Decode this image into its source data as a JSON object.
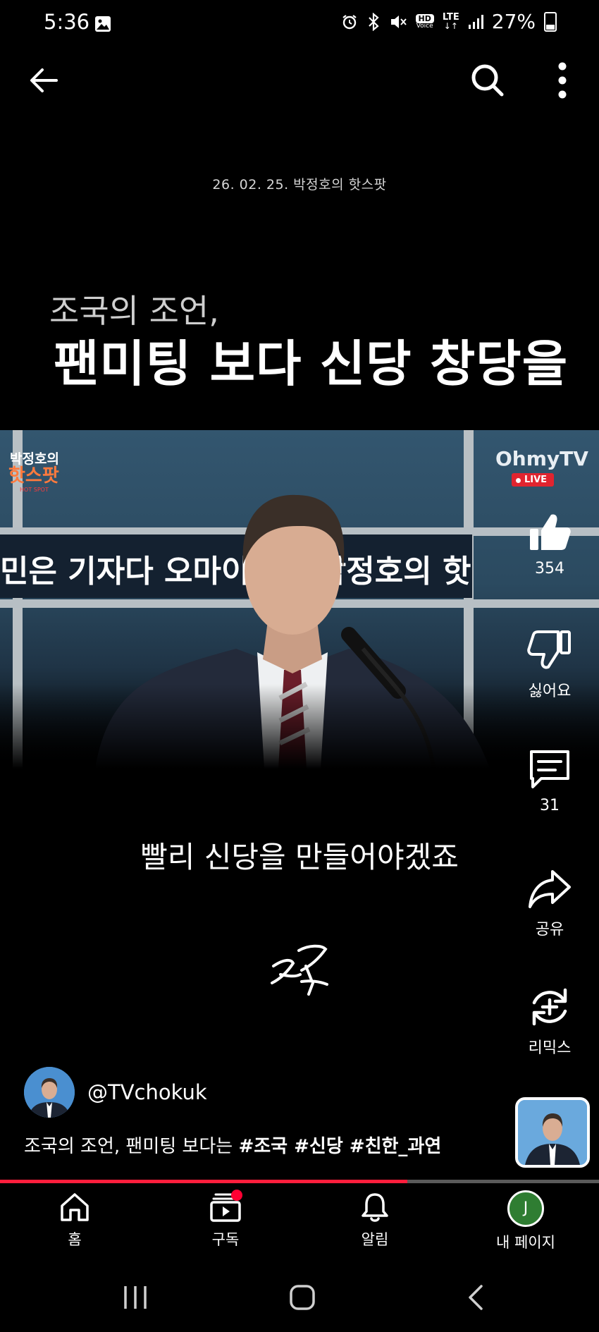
{
  "status_bar": {
    "time": "5:36",
    "battery": "27%",
    "icons": [
      "gallery-icon",
      "alarm-icon",
      "bluetooth-icon",
      "mute-icon",
      "hd-voice-icon",
      "lte-icon",
      "signal-icon",
      "battery-icon"
    ],
    "hd_label": "HD",
    "lte_label": "LTE"
  },
  "top_bar": {
    "icons": [
      "back-arrow-icon",
      "search-icon",
      "more-vertical-icon"
    ]
  },
  "video": {
    "date_caption": "26. 02. 25. 박정호의 핫스팟",
    "headline_small": "조국의 조언,",
    "headline_big": "팬미팅 보다 신당 창당을",
    "ticker_text": "민은 기자다 오마이뉴스 박정호의 핫",
    "program_logo_top": "박정호의",
    "program_logo_main": "핫스팟",
    "program_logo_sub": "HOT SPOT",
    "broadcaster_logo": "OhmyTV",
    "live_label": "LIVE",
    "subtitle": "빨리 신당을 만들어야겠죠",
    "signature": "조국",
    "progress_fraction": 0.68
  },
  "actions": {
    "like_count": "354",
    "dislike_label": "싫어요",
    "comment_count": "31",
    "share_label": "공유",
    "remix_label": "리믹스"
  },
  "channel": {
    "handle": "@TVchokuk",
    "title_text": "조국의 조언, 팬미팅 보다는 ",
    "title_tags": "#조국 #신당 #친한_과연"
  },
  "bottom_nav": {
    "home": "홈",
    "subscriptions": "구독",
    "notifications": "알림",
    "my_page": "내 페이지",
    "my_page_initial": "J"
  },
  "colors": {
    "background": "#000000",
    "progress": "#ff1e3c",
    "live_badge": "#e1242f",
    "subscription_dot": "#ff0033",
    "avatar_initial_bg": "#2f7d32"
  }
}
